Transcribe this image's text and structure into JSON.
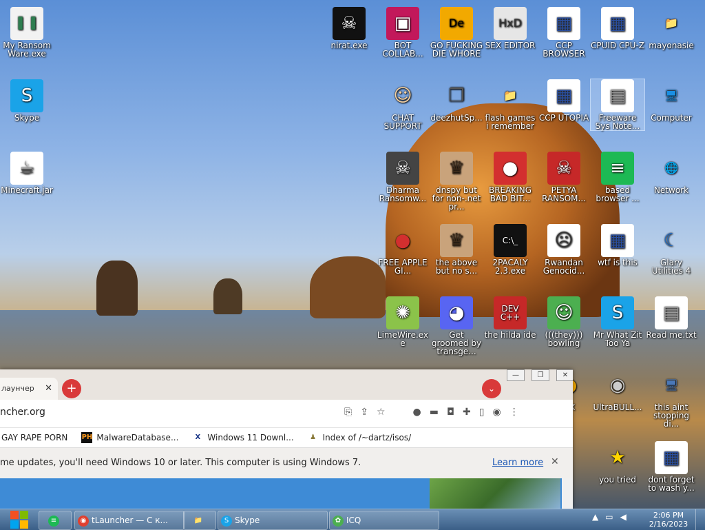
{
  "desktop_icons": [
    {
      "label": "My Ransom Ware.exe",
      "glyph": "▌▐",
      "bg": "#f2f2f2",
      "fg": "#2e7d4f"
    },
    {
      "label": "Skype",
      "glyph": "S",
      "bg": "#1aa3e8",
      "fg": "#ffffff"
    },
    {
      "label": "Minecraft.jar",
      "glyph": "☕",
      "bg": "#ffffff",
      "fg": "#555555"
    },
    {
      "label": "nirat.exe",
      "glyph": "☠",
      "bg": "#111111",
      "fg": "#ffffff"
    },
    {
      "label": "BOT COLLAB...",
      "glyph": "▣",
      "bg": "#c2185b",
      "fg": "#ffffff"
    },
    {
      "label": "GO FUCKING DIE WHORE",
      "glyph": "De",
      "bg": "#f2a900",
      "fg": "#000000"
    },
    {
      "label": "SEX EDITOR",
      "glyph": "HxD",
      "bg": "#e6e6e6",
      "fg": "#333333"
    },
    {
      "label": "CCP BROWSER",
      "glyph": "▦",
      "bg": "#ffffff",
      "fg": "#2a4fa0"
    },
    {
      "label": "CPUID CPU-Z",
      "glyph": "▦",
      "bg": "#ffffff",
      "fg": "#2a4fa0"
    },
    {
      "label": "mayonasie",
      "glyph": "📁",
      "bg": "transparent",
      "fg": "#f2c94c"
    },
    {
      "label": "CHAT SUPPORT",
      "glyph": "☺",
      "bg": "transparent",
      "fg": "#f5d0a0"
    },
    {
      "label": "deezhutSp...",
      "glyph": "❐",
      "bg": "transparent",
      "fg": "#555555"
    },
    {
      "label": "flash games i remember",
      "glyph": "📁",
      "bg": "transparent",
      "fg": "#f2c94c"
    },
    {
      "label": "CCP UTOPIA",
      "glyph": "▦",
      "bg": "#ffffff",
      "fg": "#2a4fa0"
    },
    {
      "label": "Freeware Sys Note...",
      "glyph": "▤",
      "bg": "#ffffff",
      "fg": "#999999"
    },
    {
      "label": "Computer",
      "glyph": "🖥",
      "bg": "transparent",
      "fg": "#1a8fe3"
    },
    {
      "label": "Dharma Ransomw...",
      "glyph": "☠",
      "bg": "#444444",
      "fg": "#ffffff"
    },
    {
      "label": "dnspy but for non-.net pr...",
      "glyph": "♛",
      "bg": "#c9a37b",
      "fg": "#3b2a1a"
    },
    {
      "label": "BREAKING BAD BIT...",
      "glyph": "●",
      "bg": "#d32f2f",
      "fg": "#ffffff"
    },
    {
      "label": "PETYA RANSOM...",
      "glyph": "☠",
      "bg": "#c62828",
      "fg": "#ffffff"
    },
    {
      "label": "based browser ...",
      "glyph": "≡",
      "bg": "#1db954",
      "fg": "#ffffff"
    },
    {
      "label": "Network",
      "glyph": "🌐",
      "bg": "transparent",
      "fg": "#2e9be8"
    },
    {
      "label": "FREE APPLE GI...",
      "glyph": "●",
      "bg": "transparent",
      "fg": "#d32f2f"
    },
    {
      "label": "the above but no s...",
      "glyph": "♛",
      "bg": "#c9a37b",
      "fg": "#3b2a1a"
    },
    {
      "label": "2PACALY 2.3.exe",
      "glyph": "C:\\_",
      "bg": "#111111",
      "fg": "#ffffff"
    },
    {
      "label": "Rwandan Genocid...",
      "glyph": "☹",
      "bg": "#ffffff",
      "fg": "#333333"
    },
    {
      "label": "wtf is this",
      "glyph": "▦",
      "bg": "#ffffff",
      "fg": "#2a4fa0"
    },
    {
      "label": "Glary Utilities 4",
      "glyph": "☾",
      "bg": "transparent",
      "fg": "#1a6fd3"
    },
    {
      "label": "LimeWire.exe",
      "glyph": "✺",
      "bg": "#8bc34a",
      "fg": "#ffffff"
    },
    {
      "label": "Get groomed by transge...",
      "glyph": "◕",
      "bg": "#5865f2",
      "fg": "#ffffff"
    },
    {
      "label": "the hilda ide",
      "glyph": "DEV C++",
      "bg": "#c62828",
      "fg": "#ffffff"
    },
    {
      "label": "(((they))) bowling",
      "glyph": "☺",
      "bg": "#4caf50",
      "fg": "#ffffff"
    },
    {
      "label": "Mr What Zit Too Ya",
      "glyph": "S",
      "bg": "#1aa3e8",
      "fg": "#ffffff"
    },
    {
      "label": "Read me.txt",
      "glyph": "▤",
      "bg": "#ffffff",
      "fg": "#999999"
    },
    {
      "label": "UltraBULL...",
      "glyph": "◉",
      "bg": "transparent",
      "fg": "#cccccc"
    },
    {
      "label": "this aint stopping di...",
      "glyph": "🖥",
      "bg": "transparent",
      "fg": "#4a78b8"
    },
    {
      "label": "you tried",
      "glyph": "★",
      "bg": "transparent",
      "fg": "#ffd400"
    },
    {
      "label": "dont forget to wash y...",
      "glyph": "▦",
      "bg": "#ffffff",
      "fg": "#2a4fa0"
    },
    {
      "label": "OX",
      "glyph": "●",
      "bg": "transparent",
      "fg": "#f2a900"
    }
  ],
  "browser": {
    "tab_title": "лаунчер",
    "tab_close": "✕",
    "new_tab": "+",
    "tab_search": "⌄",
    "win_min": "—",
    "win_max": "❐",
    "win_close": "✕",
    "url": "ncher.org",
    "bookmarks": [
      {
        "label": "GAY RAPE PORN",
        "fav": "",
        "fav_bg": "transparent",
        "fav_fg": "#000"
      },
      {
        "label": "MalwareDatabase...",
        "fav": "PH",
        "fav_bg": "#111111",
        "fav_fg": "#f7971d"
      },
      {
        "label": "Windows 11 Downl...",
        "fav": "X",
        "fav_bg": "#ffffff",
        "fav_fg": "#1e3a8a"
      },
      {
        "label": "Index of /~dartz/isos/",
        "fav": "♟",
        "fav_bg": "transparent",
        "fav_fg": "#8a7a3a"
      }
    ],
    "infobar_msg": "me updates, you'll need Windows 10 or later. This computer is using Windows 7.",
    "learn_more": "Learn more",
    "infobar_close": "✕"
  },
  "taskbar": {
    "items": [
      {
        "label": "",
        "icon": "≡",
        "icon_bg": "#1db954"
      },
      {
        "label": "tLauncher — С к...",
        "icon": "◉",
        "icon_bg": "#e0402f"
      },
      {
        "label": "",
        "icon": "📁",
        "icon_bg": "transparent"
      },
      {
        "label": "Skype",
        "icon": "S",
        "icon_bg": "#1aa3e8"
      },
      {
        "label": "ICQ",
        "icon": "✿",
        "icon_bg": "#4caf50"
      }
    ],
    "time": "2:06 PM",
    "date": "2/16/2023"
  }
}
